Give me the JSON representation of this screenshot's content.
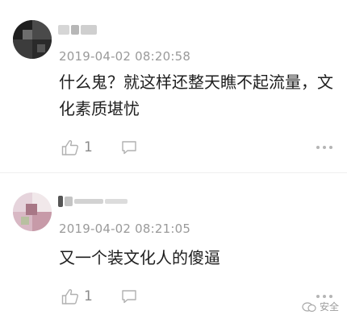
{
  "comments": [
    {
      "timestamp": "2019-04-02 08:20:58",
      "text": "什么鬼？就这样还整天瞧不起流量，文化素质堪忧",
      "like_count": "1"
    },
    {
      "timestamp": "2019-04-02 08:21:05",
      "text": "又一个装文化人的傻逼",
      "like_count": "1"
    }
  ],
  "icons": {
    "like": "thumbs-up-icon",
    "reply": "comment-bubble-icon",
    "more": "more-dots-icon"
  },
  "watermark_text": "安全"
}
